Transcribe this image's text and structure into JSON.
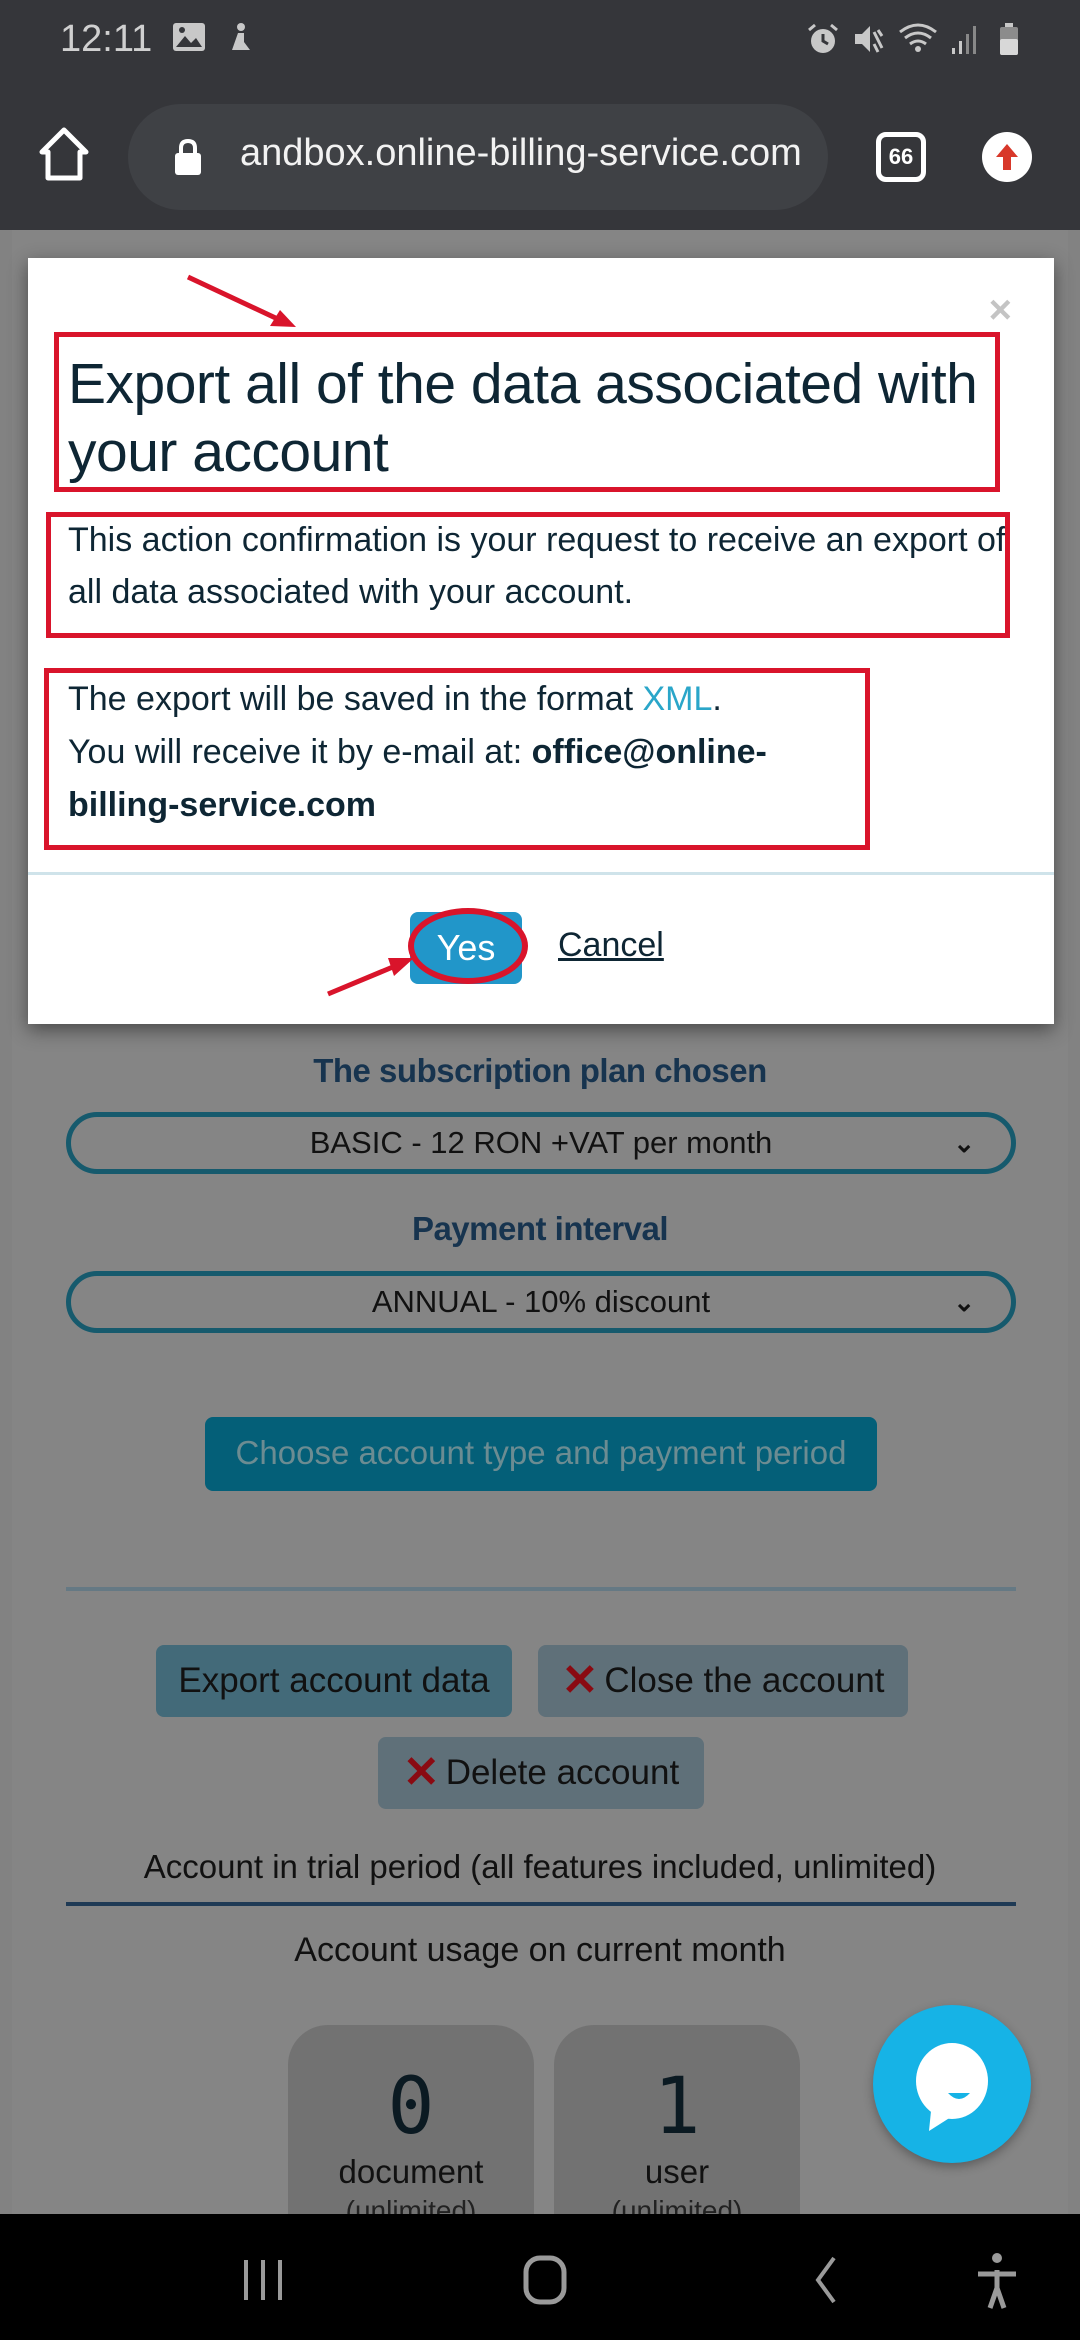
{
  "status_bar": {
    "time": "12:11",
    "left_icons": [
      "gallery-icon",
      "accessibility-notification-icon"
    ],
    "right_icons": [
      "alarm-icon",
      "mute-icon",
      "wifi-icon",
      "signal-icon",
      "battery-icon"
    ]
  },
  "browser": {
    "url": "andbox.online-billing-service.com",
    "tab_count": "66"
  },
  "page": {
    "subscription_label": "The subscription plan chosen",
    "subscription_value": "BASIC - 12 RON +VAT per month",
    "payment_label": "Payment interval",
    "payment_value": "ANNUAL - 10% discount",
    "choose_button": "Choose account type and payment period",
    "export_button": "Export account data",
    "close_account_button": "Close the account",
    "delete_account_button": "Delete account",
    "trial_text": "Account in trial period (all features included, unlimited)",
    "usage_title": "Account usage on current month",
    "usage_cards": [
      {
        "value": "0",
        "label": "document",
        "sub": "(unlimited)"
      },
      {
        "value": "1",
        "label": "user",
        "sub": "(unlimited)"
      }
    ]
  },
  "modal": {
    "close_symbol": "×",
    "title": "Export all of the data associated with your account",
    "paragraph1": "This action confirmation is your request to receive an export of all data associated with your account.",
    "format_prefix": "The export will be saved in the format ",
    "format_value": "XML",
    "format_suffix": ".",
    "email_prefix": "You will receive it by e-mail at: ",
    "email_value": "office@online-billing-service.com",
    "yes_button": "Yes",
    "cancel_link": "Cancel"
  },
  "colors": {
    "accent": "#2196c9",
    "annotation_red": "#d9142b",
    "chat_bubble": "#16b3e6"
  }
}
